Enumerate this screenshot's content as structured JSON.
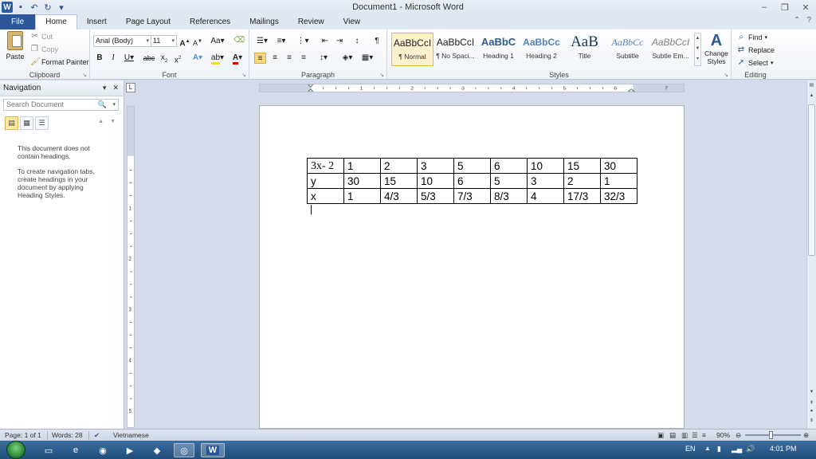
{
  "window": {
    "title": "Document1 - Microsoft Word",
    "controls": [
      "–",
      "❐",
      "✕"
    ]
  },
  "tabs": [
    "File",
    "Home",
    "Insert",
    "Page Layout",
    "References",
    "Mailings",
    "Review",
    "View"
  ],
  "ribbon": {
    "clipboard": {
      "label": "Clipboard",
      "paste": "Paste",
      "cut": "Cut",
      "copy": "Copy",
      "format_painter": "Format Painter"
    },
    "font": {
      "label": "Font",
      "face": "Arial (Body)",
      "size": "11"
    },
    "paragraph": {
      "label": "Paragraph"
    },
    "styles": {
      "label": "Styles",
      "tiles": [
        {
          "preview": "AaBbCcI",
          "name": "¶ Normal"
        },
        {
          "preview": "AaBbCcI",
          "name": "¶ No Spaci..."
        },
        {
          "preview": "AaBbC",
          "name": "Heading 1"
        },
        {
          "preview": "AaBbCc",
          "name": "Heading 2"
        },
        {
          "preview": "AaB",
          "name": "Title"
        },
        {
          "preview": "AaBbCc",
          "name": "Subtitle"
        },
        {
          "preview": "AaBbCcI",
          "name": "Subtle Em..."
        }
      ],
      "change_styles": "Change Styles"
    },
    "editing": {
      "label": "Editing",
      "find": "Find",
      "replace": "Replace",
      "select": "Select"
    }
  },
  "navigation": {
    "title": "Navigation",
    "search_placeholder": "Search Document",
    "message1": "This document does not contain headings.",
    "message2": "To create navigation tabs, create headings in your document by applying Heading Styles."
  },
  "document": {
    "table": [
      [
        "3x- 2",
        "1",
        "2",
        "3",
        "5",
        "6",
        "10",
        "15",
        "30"
      ],
      [
        "y",
        "30",
        "15",
        "10",
        "6",
        "5",
        "3",
        "2",
        "1"
      ],
      [
        "x",
        "1",
        "4/3",
        "5/3",
        "7/3",
        "8/3",
        "4",
        "17/3",
        "32/3"
      ]
    ]
  },
  "status": {
    "page": "Page: 1 of 1",
    "words": "Words: 28",
    "language": "Vietnamese",
    "zoom": "90%"
  },
  "taskbar": {
    "lang": "EN",
    "time": "4:01 PM"
  }
}
